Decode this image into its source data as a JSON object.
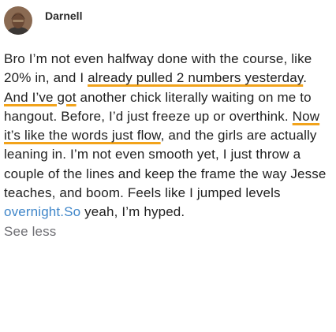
{
  "post": {
    "author": "Darnell",
    "avatar_icon": "user-avatar-icon",
    "segments": [
      {
        "text": "Bro I’m not even halfway done with the course, like 20% in, and I ",
        "style": "plain"
      },
      {
        "text": "already pulled 2 numbers yesterday",
        "style": "underline"
      },
      {
        "text": ". ",
        "style": "plain"
      },
      {
        "text": "And I’ve got",
        "style": "underline"
      },
      {
        "text": " another chick literally waiting on me to hangout. Before, I’d just freeze up or overthink. ",
        "style": "plain"
      },
      {
        "text": "Now it’s like the words just flow",
        "style": "underline"
      },
      {
        "text": ", and the girls are actually leaning in. I’m not even smooth yet, I just throw a couple of the lines and keep the frame the way Jesse teaches, and boom. Feels like I jumped levels ",
        "style": "plain"
      },
      {
        "text": "overnight.So",
        "style": "link"
      },
      {
        "text": " yeah, I’m hyped.",
        "style": "plain"
      }
    ],
    "see_less_label": "See less"
  },
  "colors": {
    "underline_accent": "#f2a31b",
    "link": "#3f86c9",
    "muted": "#6e6e73"
  }
}
